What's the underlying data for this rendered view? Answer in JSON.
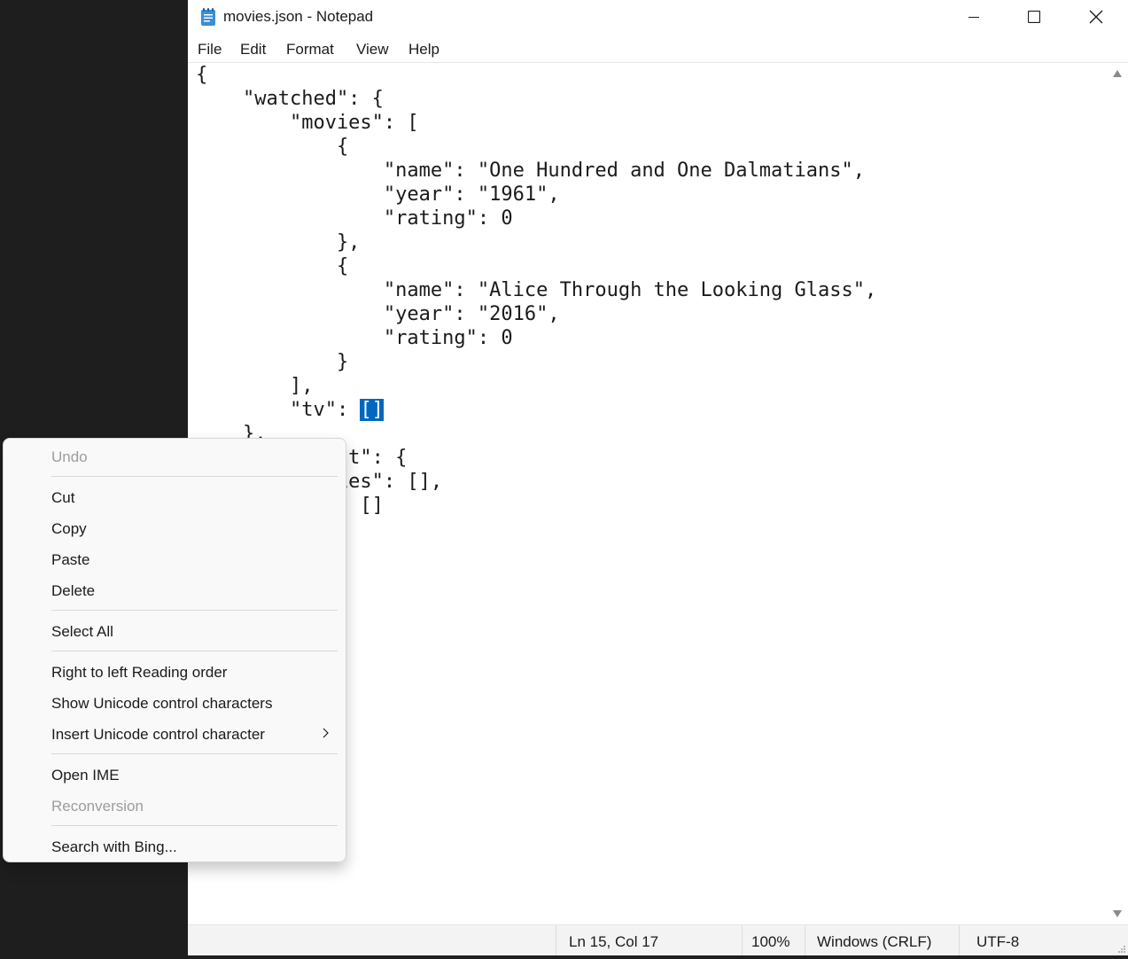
{
  "window": {
    "title": "movies.json - Notepad",
    "icons": {
      "app": "notepad-icon",
      "minimize": "minimize-icon",
      "maximize": "maximize-icon",
      "close": "close-icon"
    }
  },
  "menu": {
    "file": "File",
    "edit": "Edit",
    "format": "Format",
    "view": "View",
    "help": "Help"
  },
  "editor": {
    "lines": [
      "{",
      "    \"watched\": {",
      "        \"movies\": [",
      "            {",
      "                \"name\": \"One Hundred and One Dalmatians\",",
      "                \"year\": \"1961\",",
      "                \"rating\": 0",
      "            },",
      "            {",
      "                \"name\": \"Alice Through the Looking Glass\",",
      "                \"year\": \"2016\",",
      "                \"rating\": 0",
      "            }",
      "        ],",
      "        \"tv\": ",
      "    },",
      "    \"watchlist\": {",
      "        \"movies\": [],",
      "        \"tv\": []"
    ],
    "selected_text": "[]",
    "selection_color": "#0067c0"
  },
  "status": {
    "position": "Ln 15, Col 17",
    "zoom": "100%",
    "line_ending": "Windows (CRLF)",
    "encoding": "UTF-8"
  },
  "context_menu": {
    "undo": "Undo",
    "cut": "Cut",
    "copy": "Copy",
    "paste": "Paste",
    "delete": "Delete",
    "select_all": "Select All",
    "rtl": "Right to left Reading order",
    "show_unicode": "Show Unicode control characters",
    "insert_unicode": "Insert Unicode control character",
    "open_ime": "Open IME",
    "reconversion": "Reconversion",
    "search_bing": "Search with Bing..."
  }
}
